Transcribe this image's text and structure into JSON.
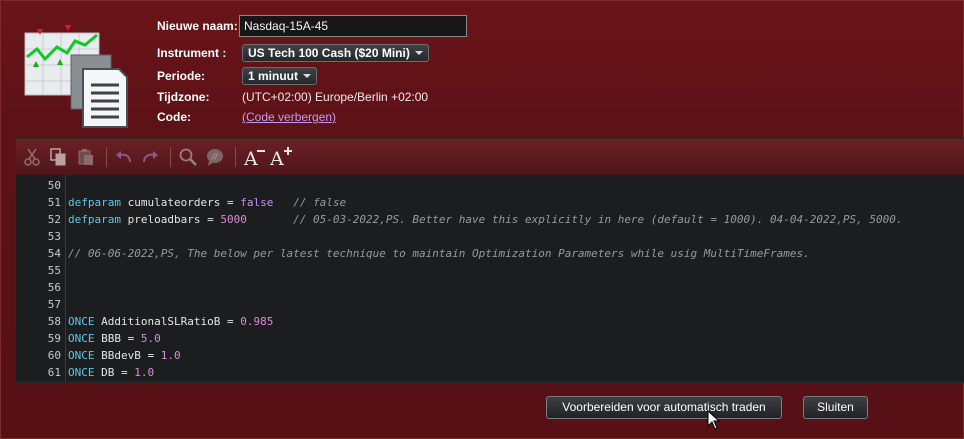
{
  "form": {
    "name_label": "Nieuwe naam:",
    "name_value": "Nasdaq-15A-45",
    "instrument_label": "Instrument :",
    "instrument_value": "US Tech 100 Cash ($20 Mini)",
    "period_label": "Periode:",
    "period_value": "1 minuut",
    "timezone_label": "Tijdzone:",
    "timezone_value": "(UTC+02:00) Europe/Berlin +02:00",
    "code_label": "Code:",
    "code_link": "(Code verbergen)"
  },
  "toolbar": {
    "icons": [
      "cut-icon",
      "copy-icon",
      "paste-icon",
      "undo-icon",
      "redo-icon",
      "search-icon",
      "comment-icon",
      "font-decrease-icon",
      "font-increase-icon"
    ],
    "font_minus_label": "A",
    "font_plus_label": "A"
  },
  "code_lines": [
    {
      "n": "50"
    },
    {
      "n": "51",
      "kw": "defparam",
      "name": " cumulateorders ",
      "op": "= ",
      "val": "false",
      "val_type": "bool",
      "cmt": "   // false"
    },
    {
      "n": "52",
      "kw": "defparam",
      "name": " preloadbars ",
      "op": "= ",
      "val": "5000",
      "val_type": "num",
      "cmt": "       // 05-03-2022,PS. Better have this explicitly in here (default = 1000). 04-04-2022,PS, 5000."
    },
    {
      "n": "53"
    },
    {
      "n": "54",
      "cmt": "// 06-06-2022,PS, The below per latest technique to maintain Optimization Parameters while usig MultiTimeFrames."
    },
    {
      "n": "55"
    },
    {
      "n": "56"
    },
    {
      "n": "57"
    },
    {
      "n": "58",
      "kw": "ONCE",
      "name": " AdditionalSLRatioB ",
      "op": "= ",
      "val": "0.985",
      "val_type": "num"
    },
    {
      "n": "59",
      "kw": "ONCE",
      "name": " BBB ",
      "op": "= ",
      "val": "5.0",
      "val_type": "num"
    },
    {
      "n": "60",
      "kw": "ONCE",
      "name": " BBdevB ",
      "op": "= ",
      "val": "1.0",
      "val_type": "num"
    },
    {
      "n": "61",
      "kw": "ONCE",
      "name": " DB ",
      "op": "= ",
      "val": "1.0",
      "val_type": "num"
    }
  ],
  "buttons": {
    "prepare_label": "Voorbereiden voor automatisch traden",
    "close_label": "Sluiten"
  },
  "colors": {
    "background": "#5a1116",
    "keyword": "#5fc7e8",
    "number": "#d98dd9",
    "comment": "#9a9a9a",
    "link": "#c79bf2"
  }
}
